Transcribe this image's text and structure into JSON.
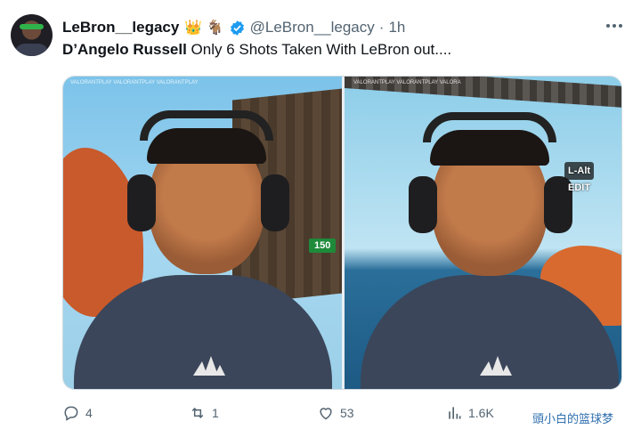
{
  "tweet": {
    "display_name": "LeBron__legacy",
    "emojis": "👑 🐐",
    "handle": "@LeBron__legacy",
    "separator": "·",
    "time": "1h",
    "text_bold": "D’Angelo Russell",
    "text_rest": " Only 6 Shots Taken With LeBron out...."
  },
  "media": {
    "left_badge": "150",
    "left_watermark": "VALORANTPLAY VALORANTPLAY VALORANTPLAY",
    "right_watermark": "VALORANTPLAY VALORANTPLAY VALORA",
    "key_label": "L-Alt",
    "key_action": "EDIT"
  },
  "actions": {
    "replies": "4",
    "reposts": "1",
    "likes": "53",
    "views": "1.6K"
  },
  "watermark": "頭小白的篮球梦",
  "colors": {
    "verified": "#1d9bf0",
    "secondary_text": "#536471"
  }
}
